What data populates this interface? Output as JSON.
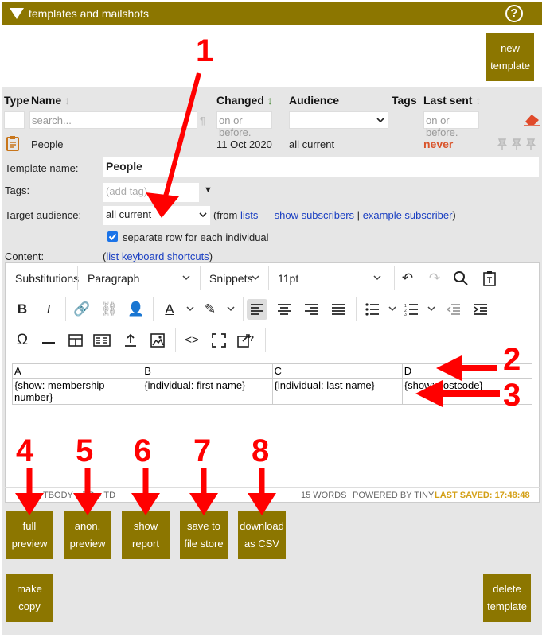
{
  "titlebar": {
    "title": "templates and mailshots",
    "help_glyph": "?"
  },
  "new_template_button": "new\ntemplate",
  "table": {
    "headers": {
      "type": "Type",
      "name": "Name",
      "changed": "Changed",
      "audience": "Audience",
      "tags": "Tags",
      "last_sent": "Last sent"
    },
    "filters": {
      "name_placeholder": "search...",
      "changed_placeholder": "on or before.",
      "last_sent_placeholder": "on or before."
    },
    "row": {
      "name": "People",
      "changed": "11 Oct 2020",
      "audience": "all current",
      "last_sent": "never"
    }
  },
  "form": {
    "template_name_label": "Template name:",
    "template_name_value": "People",
    "tags_label": "Tags:",
    "tags_placeholder": "(add tag)",
    "tags_dropdown": "▼",
    "target_audience_label": "Target audience:",
    "target_audience_value": "all current",
    "from_prefix": "(from",
    "lists_link": "lists",
    "dash": "—",
    "show_subscribers_link": "show subscribers",
    "pipe": "|",
    "example_subscriber_link": "example subscriber",
    "close_paren": ")",
    "separate_row_label": "separate row for each individual",
    "content_label": "Content:",
    "open_paren": "(",
    "keyboard_shortcuts_link": "list keyboard shortcuts"
  },
  "editor": {
    "toolbar": {
      "substitutions": "Substitutions",
      "block_format": "Paragraph",
      "snippets": "Snippets",
      "font_size": "11pt"
    },
    "table": {
      "headers": [
        "A",
        "B",
        "C",
        "D"
      ],
      "cells": [
        "{show: membership number}",
        "{individual: first name}",
        "{individual: last name}",
        "{show: postcode}"
      ]
    },
    "status": {
      "path": "TBODY » TR » TD",
      "words": "15 WORDS",
      "powered": "POWERED BY TINY",
      "saved": "LAST SAVED: 17:48:48"
    }
  },
  "buttons": {
    "full_preview": "full\npreview",
    "anon_preview": "anon.\npreview",
    "show_report": "show\nreport",
    "save_to_file_store": "save to\nfile store",
    "download_csv": "download\nas CSV",
    "make_copy": "make\ncopy",
    "delete_template": "delete\ntemplate"
  },
  "annotations": [
    "1",
    "2",
    "3",
    "4",
    "5",
    "6",
    "7",
    "8"
  ],
  "colors": {
    "gold": "#8c7600",
    "panel": "#e6e6e6",
    "link": "#1a3fc2",
    "never": "#d9542b",
    "annotation": "#ff0000",
    "saved": "#d4a017"
  }
}
